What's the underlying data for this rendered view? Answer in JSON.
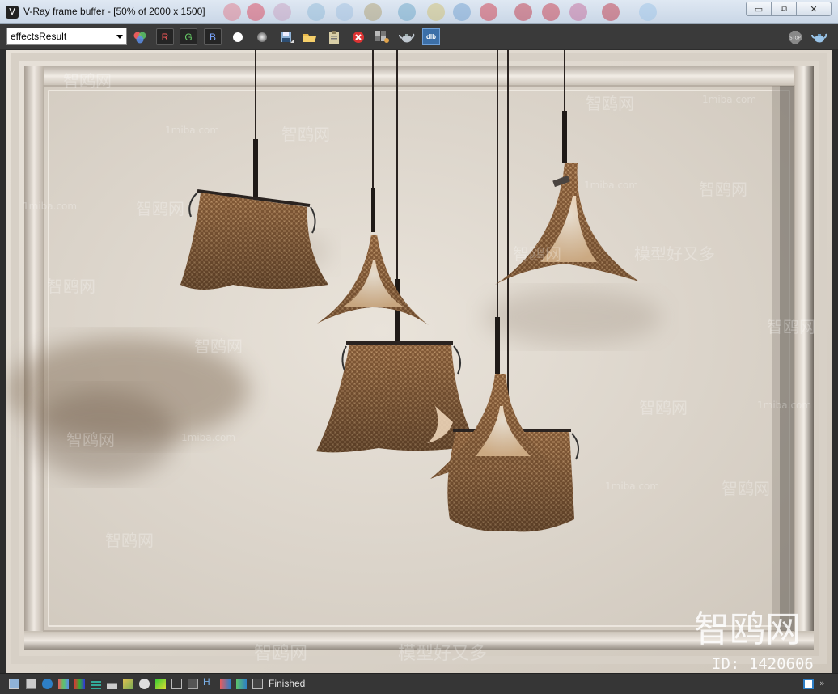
{
  "window": {
    "title": "V-Ray frame buffer - [50% of 2000 x 1500]",
    "app_icon_glyph": "V",
    "minimize_glyph": "▭",
    "restore_glyph": "⧉",
    "close_glyph": "✕"
  },
  "toolbar": {
    "channel_value": "effectsResult",
    "red_label": "R",
    "green_label": "G",
    "blue_label": "B",
    "dlb_label": "dlb",
    "stop_label": "STOP"
  },
  "status": {
    "text": "Finished",
    "h_label": "H"
  },
  "watermarks": {
    "site": "1miba.com",
    "brand": "智鸥网",
    "slogan": "模型好又多",
    "id_label": "ID: 1420606"
  },
  "colors": {
    "accent_blue": "#2e7fc6",
    "toolbar_bg": "#3a3a3a",
    "red": "#e8595b",
    "green": "#5fc46a"
  }
}
